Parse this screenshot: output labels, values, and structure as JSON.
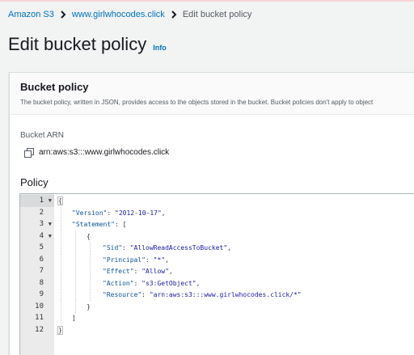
{
  "breadcrumb": {
    "items": [
      "Amazon S3",
      "www.girlwhocodes.click"
    ],
    "current": "Edit bucket policy"
  },
  "page": {
    "title": "Edit bucket policy",
    "info": "Info"
  },
  "panel": {
    "title": "Bucket policy",
    "description": "The bucket policy, written in JSON, provides access to the objects stored in the bucket. Bucket policies don't apply to object"
  },
  "arn": {
    "label": "Bucket ARN",
    "value": "arn:aws:s3:::www.girlwhocodes.click"
  },
  "policy": {
    "label": "Policy",
    "lines": [
      {
        "n": "1",
        "fold": "▼",
        "text": "{"
      },
      {
        "n": "2",
        "fold": "",
        "key": "\"Version\"",
        "sep": ": ",
        "val": "\"2012-10-17\"",
        "end": ","
      },
      {
        "n": "3",
        "fold": "▼",
        "key": "\"Statement\"",
        "sep": ": ",
        "val": "",
        "end": "["
      },
      {
        "n": "4",
        "fold": "▼",
        "text": "{"
      },
      {
        "n": "5",
        "fold": "",
        "key": "\"Sid\"",
        "sep": ": ",
        "val": "\"AllowReadAccessToBucket\"",
        "end": ","
      },
      {
        "n": "6",
        "fold": "",
        "key": "\"Principal\"",
        "sep": ": ",
        "val": "\"*\"",
        "end": ","
      },
      {
        "n": "7",
        "fold": "",
        "key": "\"Effect\"",
        "sep": ": ",
        "val": "\"Allow\"",
        "end": ","
      },
      {
        "n": "8",
        "fold": "",
        "key": "\"Action\"",
        "sep": ": ",
        "val": "\"s3:GetObject\"",
        "end": ","
      },
      {
        "n": "9",
        "fold": "",
        "key": "\"Resource\"",
        "sep": ": ",
        "val": "\"arn:aws:s3:::www.girlwhocodes.click/*\"",
        "end": ""
      },
      {
        "n": "10",
        "fold": "",
        "text": "}"
      },
      {
        "n": "11",
        "fold": "",
        "text": "]"
      },
      {
        "n": "12",
        "fold": "",
        "text": "}"
      }
    ]
  }
}
